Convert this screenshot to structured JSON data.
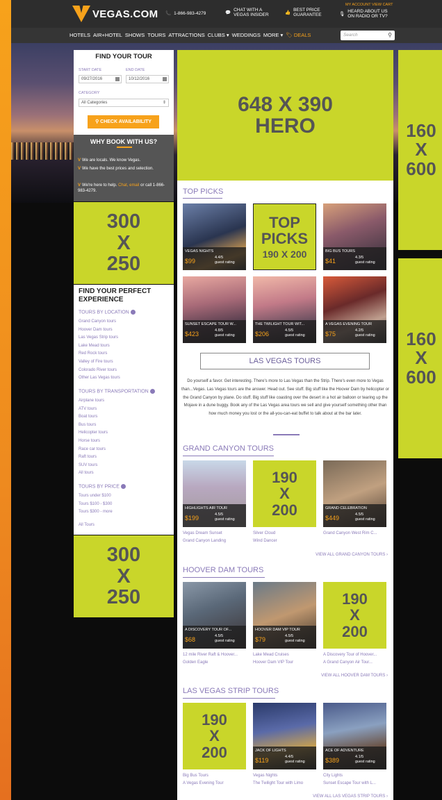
{
  "header": {
    "brand": "VEGAS.COM",
    "phone": "1-866-983-4279",
    "chat": [
      "CHAT WITH A",
      "VEGAS INSIDER"
    ],
    "price": [
      "BEST PRICE",
      "GUARANTEE"
    ],
    "radio": [
      "HEARD ABOUT US",
      "ON RADIO OR TV?"
    ],
    "account": "MY ACCOUNT  VIEW CART"
  },
  "nav": {
    "items": [
      "HOTELS",
      "AIR+HOTEL",
      "SHOWS",
      "TOURS",
      "ATTRACTIONS",
      "CLUBS ▾",
      "WEDDINGS",
      "MORE ▾"
    ],
    "deals": "DEALS",
    "search_placeholder": "Search"
  },
  "finder": {
    "title": "FIND YOUR TOUR",
    "start_label": "START DATE",
    "end_label": "END DATE",
    "start": "09/27/2016",
    "end": "10/12/2016",
    "category_label": "CATEGORY",
    "category": "All Categories",
    "button": "CHECK AVAILABILITY"
  },
  "why": {
    "title": "WHY BOOK WITH US?",
    "items": [
      "We are locals. We know Vegas.",
      "We have the best prices and selection.",
      "We're here to help. "
    ],
    "help_links": "Chat, email",
    "help_tail": " or call 1-866-983-4279."
  },
  "ads": {
    "side1": [
      "300",
      "X",
      "250"
    ],
    "side2": [
      "300",
      "X",
      "250"
    ],
    "hero": [
      "648 X 390",
      "HERO"
    ],
    "sky1": [
      "160",
      "X",
      "600"
    ],
    "sky2": [
      "160",
      "X",
      "600"
    ],
    "toppicks": [
      "TOP",
      "PICKS"
    ],
    "toppicks_size": "190 X 200",
    "gc": [
      "190",
      "X",
      "200"
    ],
    "hd": [
      "190",
      "X",
      "200"
    ],
    "ls": [
      "190",
      "X",
      "200"
    ]
  },
  "perfect": {
    "title": "FIND YOUR PERFECT EXPERIENCE",
    "location_label": "TOURS BY LOCATION",
    "location": [
      "Grand Canyon tours",
      "Hoover Dam tours",
      "Las Vegas Strip tours",
      "Lake Mead tours",
      "Red Rock tours",
      "Valley of Fire tours",
      "Colorado River tours",
      "Other Las Vegas tours"
    ],
    "transport_label": "TOURS BY TRANSPORTATION",
    "transport": [
      "Airplane tours",
      "ATV tours",
      "Boat tours",
      "Bus tours",
      "Helicopter tours",
      "Horse tours",
      "Race car tours",
      "Raft tours",
      "SUV tours",
      "All tours"
    ],
    "price_label": "TOURS BY PRICE",
    "price": [
      "Tours under $100",
      "Tours $100 - $300",
      "Tours $300 - more"
    ],
    "all": "All Tours"
  },
  "toppicks": {
    "heading": "TOP PICKS",
    "cards": [
      {
        "name": "VEGAS NIGHTS",
        "price": "$99",
        "rating": "4.4/5",
        "rating_label": "guest rating"
      },
      {
        "name": "BIG BUS TOURS",
        "price": "$41",
        "rating": "4.3/5",
        "rating_label": "guest rating"
      },
      {
        "name": "SUNSET ESCAPE TOUR W...",
        "price": "$423",
        "rating": "4.8/5",
        "rating_label": "guest rating"
      },
      {
        "name": "THE TWILIGHT TOUR WIT...",
        "price": "$206",
        "rating": "4.5/5",
        "rating_label": "guest rating"
      },
      {
        "name": "A VEGAS EVENING TOUR",
        "price": "$75",
        "rating": "4.2/5",
        "rating_label": "guest rating"
      }
    ]
  },
  "lvtours": {
    "heading": "LAS VEGAS TOURS",
    "text": "Do yourself a favor. Get interesting. There's more to Las Vegas than the Strip. There's even more to Vegas than...Vegas. Las Vegas tours are the answer. Head out. See stuff. Big stuff like the Hoover Dam by helicopter or the Grand Canyon by plane. Do stuff. Big stuff like coasting over the desert in a hot air balloon or tearing up the Mojave in a dune buggy. Book any of the Las Vegas area tours we sell and give yourself something other than how much money you lost or the all-you-can-eat buffet to talk about at the bar later."
  },
  "grand": {
    "heading": "GRAND CANYON TOURS",
    "cards": [
      {
        "name": "HIGHLIGHTS AIR TOUR",
        "price": "$199",
        "rating": "4.5/5",
        "rating_label": "guest rating"
      },
      {
        "name": "GRAND CELEBRATION",
        "price": "$449",
        "rating": "4.5/5",
        "rating_label": "guest rating"
      }
    ],
    "links": [
      [
        "Vegas Dream Sunset",
        "Grand Canyon Landing"
      ],
      [
        "Silver Cloud",
        "Wind Dancer"
      ],
      [
        "Grand Canyon West Rim C..."
      ]
    ],
    "viewall": "VIEW ALL GRAND CANYON TOURS ›"
  },
  "hoover": {
    "heading": "HOOVER DAM TOURS",
    "cards": [
      {
        "name": "A DISCOVERY TOUR OF...",
        "price": "$68",
        "rating": "4.5/5",
        "rating_label": "guest rating"
      },
      {
        "name": "HOOVER DAM VIP TOUR",
        "price": "$79",
        "rating": "4.5/5",
        "rating_label": "guest rating"
      }
    ],
    "links": [
      [
        "12 mile River Raft & Hoover...",
        "Golden Eagle"
      ],
      [
        "Lake Mead Cruises",
        "Hoover Dam VIP Tour"
      ],
      [
        "A Discovery Tour of Hoover...",
        "A Grand Canyon Air Tour..."
      ]
    ],
    "viewall": "VIEW ALL HOOVER DAM TOURS ›"
  },
  "strip": {
    "heading": "LAS VEGAS STRIP TOURS",
    "cards": [
      {
        "name": "JACK OF LIGHTS",
        "price": "$119",
        "rating": "4.4/5",
        "rating_label": "guest rating"
      },
      {
        "name": "ACE OF ADVENTURE",
        "price": "$389",
        "rating": "4.1/5",
        "rating_label": "guest rating"
      }
    ],
    "links": [
      [
        "Big Bus Tours",
        "A Vegas Evening Tour"
      ],
      [
        "Vegas Nights",
        "The Twilight Tour with Limo"
      ],
      [
        "City Lights",
        "Sunset Escape Tour with L..."
      ]
    ],
    "viewall": "VIEW ALL LAS VEGAS STRIP TOURS ›"
  },
  "colors": {
    "accent": "#f7a21b",
    "ad": "#c9d62a",
    "link": "#8a7ab8",
    "bar": "#2d2d2d"
  }
}
